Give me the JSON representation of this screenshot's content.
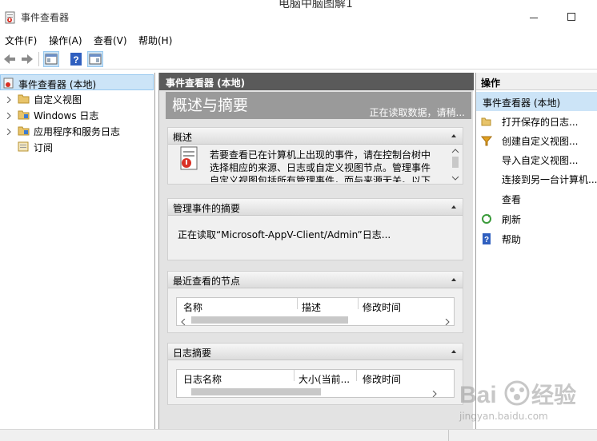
{
  "window": {
    "title": "事件查看器",
    "overlay_title": "电脑中脑图解1"
  },
  "menu": {
    "items": [
      "文件(F)",
      "操作(A)",
      "查看(V)",
      "帮助(H)"
    ]
  },
  "toolbar": {
    "buttons": [
      "back-arrow-icon",
      "forward-arrow-icon",
      "show-hide-tree-icon",
      "help-icon",
      "show-hide-actions-icon"
    ]
  },
  "tree": {
    "root": "事件查看器 (本地)",
    "items": [
      {
        "label": "自定义视图",
        "icon": "folder-icon"
      },
      {
        "label": "Windows 日志",
        "icon": "folder-log-icon"
      },
      {
        "label": "应用程序和服务日志",
        "icon": "folder-log-icon"
      },
      {
        "label": "订阅",
        "icon": "subscription-icon"
      }
    ]
  },
  "center": {
    "header": "事件查看器 (本地)",
    "overview_title": "概述与摘要",
    "loading": "正在读取数据，请稍...",
    "overview_section": {
      "title": "概述",
      "text": "若要查看已在计算机上出现的事件，请在控制台树中选择相应的来源、日志或自定义视图节点。管理事件自定义视图包括所有管理事件，而与来源无关。以下"
    },
    "admin_section": {
      "title": "管理事件的摘要",
      "status": "正在读取“Microsoft-AppV-Client/Admin”日志..."
    },
    "recent_section": {
      "title": "最近查看的节点",
      "columns": [
        "名称",
        "描述",
        "修改时间"
      ]
    },
    "log_section": {
      "title": "日志摘要",
      "columns": [
        "日志名称",
        "大小(当前...",
        "修改时间"
      ]
    }
  },
  "actions": {
    "header": "操作",
    "scope": "事件查看器 (本地)",
    "items": [
      {
        "label": "打开保存的日志...",
        "icon": "open-folder-icon"
      },
      {
        "label": "创建自定义视图...",
        "icon": "filter-icon"
      },
      {
        "label": "导入自定义视图...",
        "icon": ""
      },
      {
        "label": "连接到另一台计算机...",
        "icon": ""
      },
      {
        "label": "查看",
        "icon": ""
      },
      {
        "label": "刷新",
        "icon": "refresh-icon"
      },
      {
        "label": "帮助",
        "icon": "help-icon"
      }
    ]
  },
  "watermark": {
    "text": "jingyan.baidu.com"
  },
  "colors": {
    "center_header": "#5a5a5a",
    "selection": "#cce4f7",
    "banner": "#9a9a9a"
  }
}
